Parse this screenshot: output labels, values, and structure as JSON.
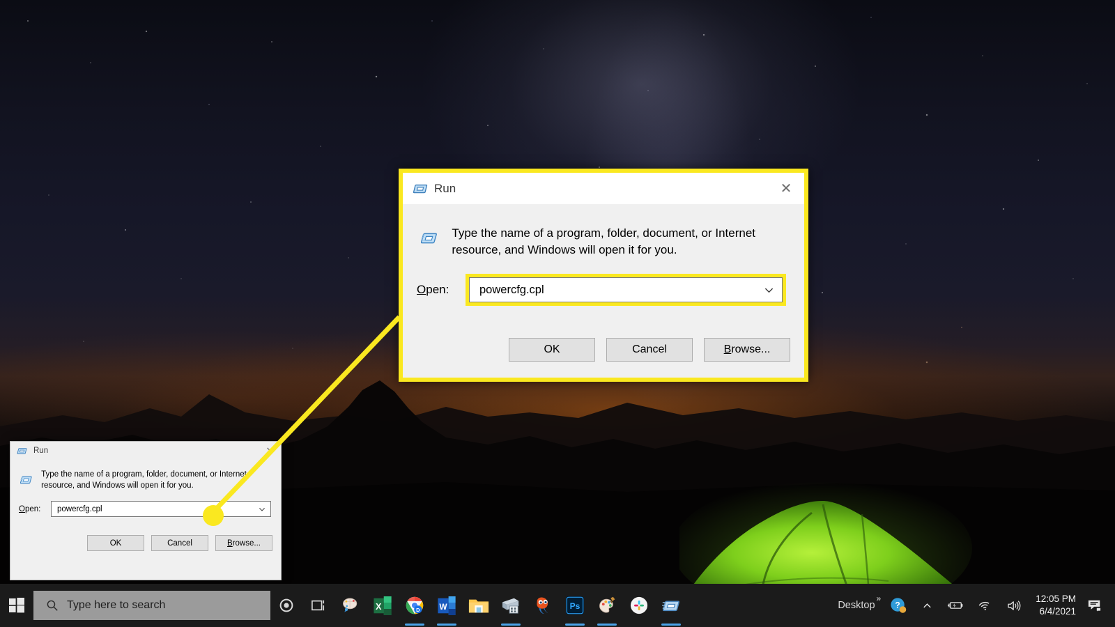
{
  "desktop": {
    "wallpaper_description": "night sky with milky way over mountain silhouettes and a glowing green tent",
    "accent_highlight_color": "#fae820",
    "tent_glow_color": "#7bcc1e"
  },
  "run_dialog": {
    "title": "Run",
    "title_icon": "run-app-icon",
    "close_icon": "close-icon",
    "app_icon": "run-app-icon-large",
    "description": "Type the name of a program, folder, document, or Internet resource, and Windows will open it for you.",
    "open_label": "Open:",
    "open_label_accel": "O",
    "open_value": "powercfg.cpl",
    "open_placeholder": "",
    "dropdown_icon": "chevron-down-icon",
    "buttons": [
      {
        "label": "OK",
        "name": "ok-button",
        "accel": ""
      },
      {
        "label": "Cancel",
        "name": "cancel-button",
        "accel": ""
      },
      {
        "label": "Browse...",
        "name": "browse-button",
        "accel": "B"
      }
    ]
  },
  "taskbar": {
    "start_icon": "windows-start-icon",
    "search": {
      "icon": "search-icon",
      "placeholder": "Type here to search",
      "value": ""
    },
    "cortana_icon": "cortana-icon",
    "taskview_icon": "task-view-icon",
    "apps": [
      {
        "name": "taskbar-app-paint-3d",
        "icon": "paint-3d-icon",
        "running": false
      },
      {
        "name": "taskbar-app-excel",
        "icon": "excel-icon",
        "running": false
      },
      {
        "name": "taskbar-app-chrome",
        "icon": "chrome-icon",
        "running": true
      },
      {
        "name": "taskbar-app-word",
        "icon": "word-icon",
        "running": true
      },
      {
        "name": "taskbar-app-file-explorer",
        "icon": "file-explorer-icon",
        "running": false
      },
      {
        "name": "taskbar-app-snipping-tool",
        "icon": "snipping-tool-icon",
        "running": true
      },
      {
        "name": "taskbar-app-gimp",
        "icon": "gimp-icon",
        "running": false
      },
      {
        "name": "taskbar-app-photoshop",
        "icon": "photoshop-icon",
        "running": true
      },
      {
        "name": "taskbar-app-paint",
        "icon": "paint-icon",
        "running": true
      },
      {
        "name": "taskbar-app-slack",
        "icon": "slack-icon",
        "running": false
      },
      {
        "name": "taskbar-app-run",
        "icon": "run-app-icon",
        "running": true
      }
    ],
    "tray": {
      "desktop_label": "Desktop",
      "overflow_label": "»",
      "help_icon": "help-question-icon",
      "show_hidden_icon": "chevron-up-icon",
      "battery_icon": "battery-charging-icon",
      "network_icon": "wifi-icon",
      "volume_icon": "speaker-icon",
      "time": "12:05 PM",
      "date": "6/4/2021",
      "action_center_icon": "notifications-icon"
    }
  },
  "callout": {
    "dot_color": "#fae820",
    "line_color": "#fae820",
    "highlight_border_color": "#fae820"
  }
}
